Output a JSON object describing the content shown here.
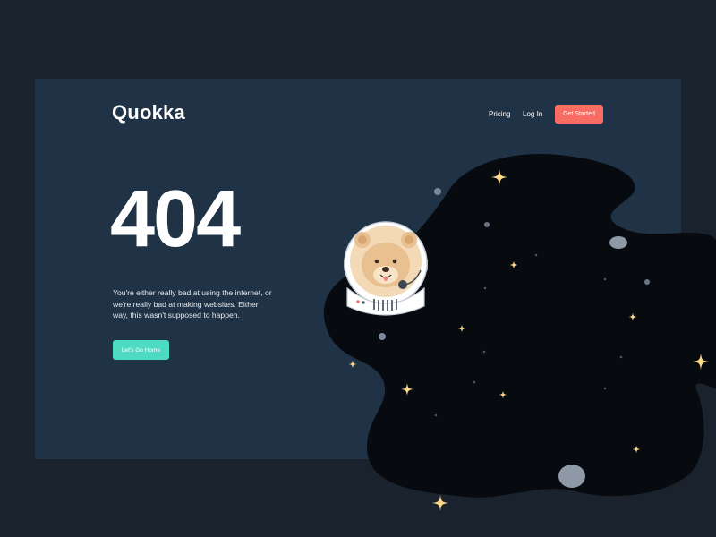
{
  "header": {
    "logo": "Quokka",
    "nav": {
      "pricing": "Pricing",
      "login": "Log In",
      "cta": "Get Started"
    }
  },
  "hero": {
    "title": "404",
    "description": "You're either really bad at using the internet, or we're really bad at making websites. Either way, this wasn't supposed to happen.",
    "button": "Let's Go Home"
  },
  "illustration": {
    "subject": "quokka-astronaut-icon",
    "decorations": [
      "star-icon",
      "planet-icon"
    ]
  },
  "colors": {
    "page_background": "#1a232d",
    "card_background": "#203246",
    "space_background": "#070b10",
    "cta_accent": "#f86c63",
    "home_button": "#4ddbc4",
    "star": "#ffd98a"
  }
}
